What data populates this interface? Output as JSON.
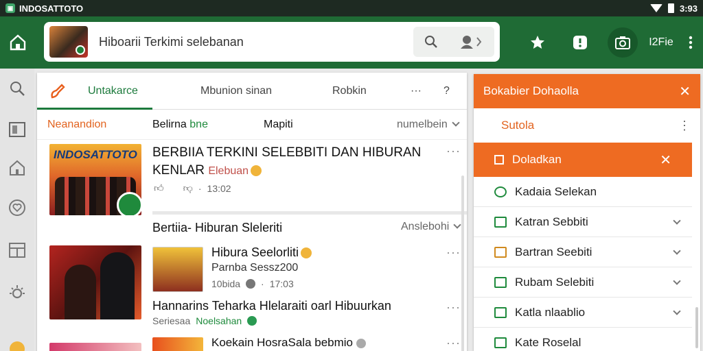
{
  "status": {
    "app_name": "INDOSATTOTO",
    "time": "3:93"
  },
  "search": {
    "query": "Hiboarii Terkimi selebanan"
  },
  "toolbar": {
    "label": "I2Fie"
  },
  "tabs": [
    {
      "label": "Untakarce"
    },
    {
      "label": "Mbunion sinan"
    },
    {
      "label": "Robkin"
    },
    {
      "label": "···"
    },
    {
      "label": "?"
    }
  ],
  "subheader": {
    "left": "Neanandion",
    "center1": "Belirna",
    "center1_accent": "bne",
    "center2": "Mapiti",
    "sort": "numelbein"
  },
  "articles": [
    {
      "thumb_brand": "INDOSATTOTO",
      "title_line1": "BERBIIA TERKINI SELEBBITI DAN HIBURAN",
      "title_line2": "KENLAR",
      "title_accent": "Elebuan",
      "time": "13:02"
    }
  ],
  "section2": {
    "title": "Bertiia- Hiburan Sleleriti",
    "sort": "Anslebohi"
  },
  "items": [
    {
      "title": "Hibura Seelorliti",
      "subtitle": "Parnba Sessz200",
      "meta": "10bida",
      "time": "17:03"
    },
    {
      "title": "Hannarins Teharka Hlelaraiti oarl Hibuurkan",
      "source": "Seriesaa",
      "source_accent": "Noelsahan"
    },
    {
      "title": "Koekain HosraSala bebmio"
    }
  ],
  "panel": {
    "header": "Bokabier Dohaolla",
    "subtitle": "Sutola",
    "selected": "Doladkan",
    "items": [
      {
        "label": "Kadaia Selekan"
      },
      {
        "label": "Katran Sebbiti"
      },
      {
        "label": "Bartran Seebiti"
      },
      {
        "label": "Rubam Selebiti"
      },
      {
        "label": "Katla nlaablio"
      },
      {
        "label": "Kate Roselal"
      }
    ]
  },
  "colors": {
    "primary_green": "#1f6b35",
    "accent_orange": "#ee6b22",
    "link_green": "#1c7a3c"
  }
}
